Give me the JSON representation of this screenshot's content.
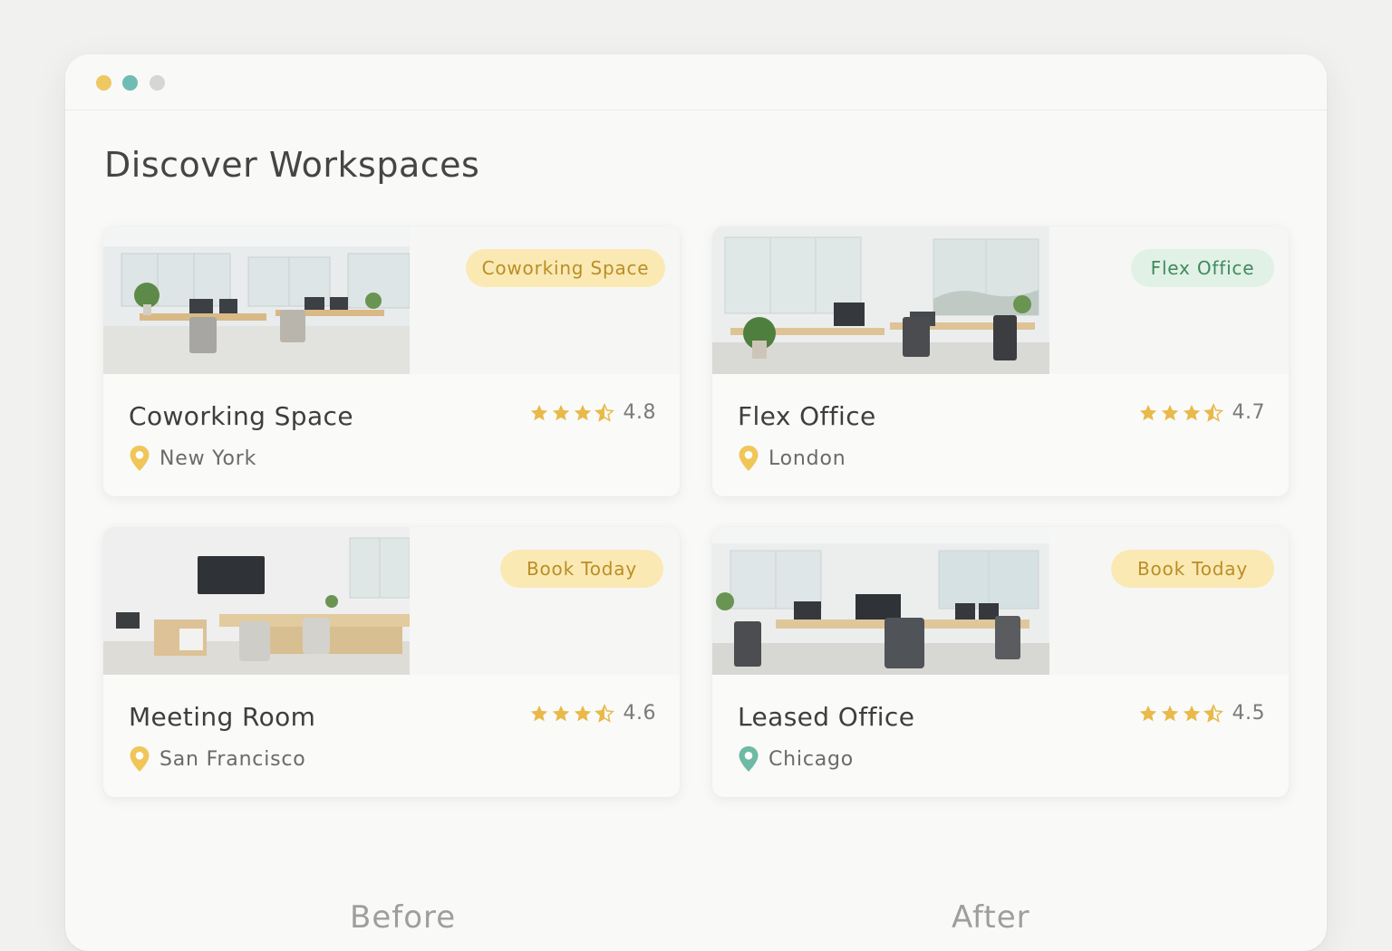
{
  "window": {
    "controls": [
      {
        "name": "minimize",
        "color": "#eec863"
      },
      {
        "name": "maximize",
        "color": "#6fbcb4"
      },
      {
        "name": "close",
        "color": "#d6d6d6"
      }
    ]
  },
  "page_title": "Discover Workspaces",
  "cards": [
    {
      "title": "Coworking Space",
      "location": "New York",
      "rating": "4.8",
      "rating_value": 4.8,
      "badge": "Coworking Space",
      "badge_style": "yellow",
      "pin_color": "#f0c659",
      "image": "open-plan-coworking-office-photo"
    },
    {
      "title": "Flex Office",
      "location": "London",
      "rating": "4.7",
      "rating_value": 4.7,
      "badge": "Flex Office",
      "badge_style": "green",
      "pin_color": "#f0c659",
      "image": "flex-office-photo"
    },
    {
      "title": "Meeting Room",
      "location": "San Francisco",
      "rating": "4.6",
      "rating_value": 4.6,
      "badge": "Book Today",
      "badge_style": "yellow",
      "pin_color": "#f0c659",
      "image": "meeting-room-photo"
    },
    {
      "title": "Leased Office",
      "location": "Chicago",
      "rating": "4.5",
      "rating_value": 4.5,
      "badge": "Book Today",
      "badge_style": "yellow",
      "pin_color": "#6fbaa4",
      "image": "leased-office-photo"
    }
  ],
  "captions": {
    "before": "Before",
    "after": "After"
  },
  "colors": {
    "badge_yellow_bg": "#fbe9b4",
    "badge_yellow_text": "#b98e25",
    "badge_green_bg": "#e1f1e6",
    "badge_green_text": "#3f8a5d",
    "star": "#e9b949"
  }
}
